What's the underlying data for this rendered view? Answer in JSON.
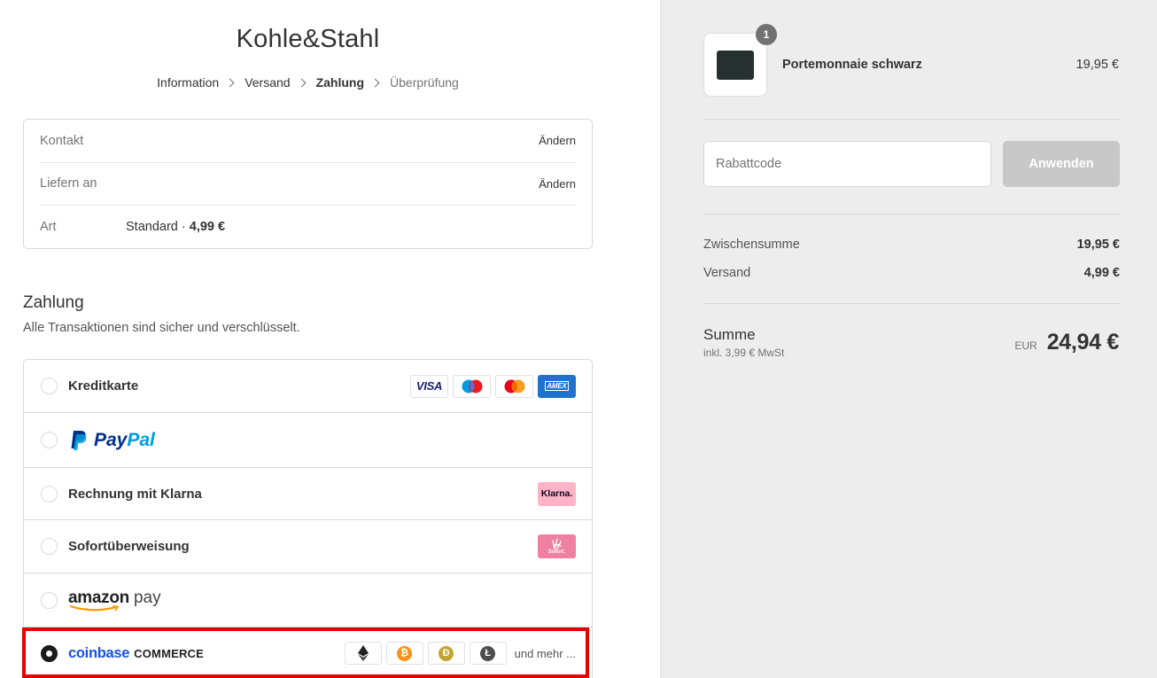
{
  "shop": {
    "title": "Kohle&Stahl"
  },
  "breadcrumb": [
    {
      "label": "Information",
      "state": "done"
    },
    {
      "label": "Versand",
      "state": "done"
    },
    {
      "label": "Zahlung",
      "state": "current"
    },
    {
      "label": "Überprüfung",
      "state": "future"
    }
  ],
  "review": {
    "contact": {
      "label": "Kontakt",
      "action": "Ändern"
    },
    "ship_to": {
      "label": "Liefern an",
      "action": "Ändern"
    },
    "method": {
      "label": "Art",
      "value_prefix": "Standard · ",
      "value_price": "4,99 €"
    }
  },
  "payment": {
    "heading": "Zahlung",
    "subtitle": "Alle Transaktionen sind sicher und verschlüsselt.",
    "methods": [
      {
        "id": "kreditkarte",
        "label": "Kreditkarte",
        "selected": false,
        "badges": [
          "VISA",
          "maestro",
          "mastercard",
          "AMEX"
        ]
      },
      {
        "id": "paypal",
        "label_a": "Pay",
        "label_b": "Pal",
        "selected": false
      },
      {
        "id": "klarna",
        "label": "Rechnung mit Klarna",
        "badge": "Klarna.",
        "selected": false
      },
      {
        "id": "sofort",
        "label": "Sofortüberweisung",
        "badge": "Sofort.",
        "selected": false
      },
      {
        "id": "amazonpay",
        "label_a": "amazon",
        "label_b": "pay",
        "selected": false
      },
      {
        "id": "coinbase",
        "label_a": "coinbase",
        "label_b": "COMMERCE",
        "selected": true,
        "coins": [
          "ethereum-icon",
          "bitcoin-icon",
          "dogecoin-icon",
          "litecoin-icon"
        ],
        "more": "und mehr ..."
      }
    ]
  },
  "colors": {
    "accent_highlight": "#e60000",
    "coinbase_blue": "#1652f0",
    "paypal_dark": "#003087",
    "paypal_light": "#009cde",
    "klarna_pink": "#ffb3c7",
    "sofort_pink": "#ef809f"
  },
  "order": {
    "item": {
      "name": "Portemonnaie schwarz",
      "price": "19,95 €",
      "quantity": "1"
    },
    "discount": {
      "placeholder": "Rabattcode",
      "button": "Anwenden"
    },
    "subtotal": {
      "label": "Zwischensumme",
      "value": "19,95 €"
    },
    "shipping": {
      "label": "Versand",
      "value": "4,99 €"
    },
    "total": {
      "label": "Summe",
      "tax_note": "inkl. 3,99 € MwSt",
      "currency": "EUR",
      "amount": "24,94 €"
    }
  }
}
